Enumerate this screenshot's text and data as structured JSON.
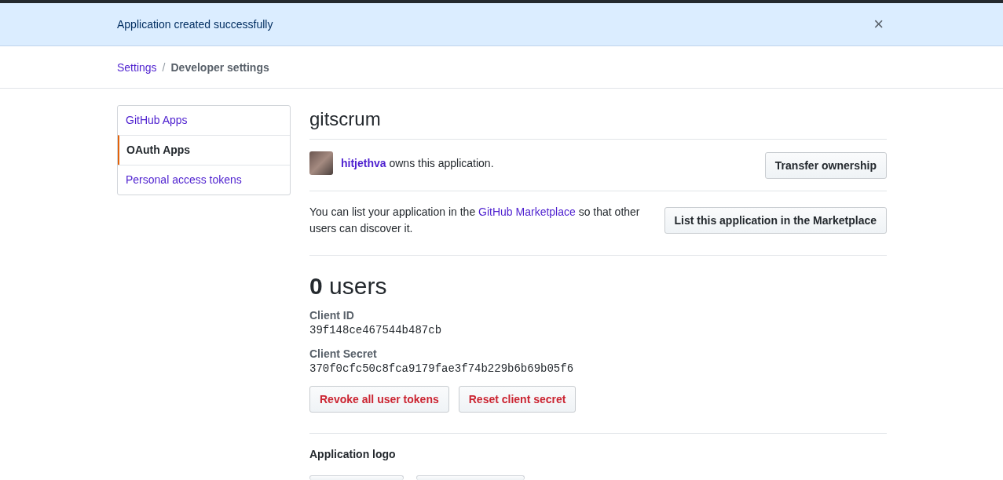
{
  "flash": {
    "message": "Application created successfully",
    "close": "×"
  },
  "breadcrumb_separator": "/",
  "breadcrumb": [
    {
      "label": "Settings",
      "kind": "link"
    },
    {
      "label": "Developer settings",
      "kind": "current"
    }
  ],
  "sidebar": {
    "items": [
      {
        "label": "GitHub Apps",
        "selected": false
      },
      {
        "label": "OAuth Apps",
        "selected": true
      },
      {
        "label": "Personal access tokens",
        "selected": false
      }
    ]
  },
  "app": {
    "name": "gitscrum",
    "owner": {
      "user": "hitjethva",
      "text": "owns this application."
    },
    "transfer_button": "Transfer ownership",
    "marketplace": {
      "before": "You can list your application in the ",
      "link": "GitHub Marketplace",
      "after": " so that other users can discover it.",
      "button": "List this application in the Marketplace"
    },
    "users": "**0** users",
    "fields": [
      {
        "label": "Client ID",
        "value": "39f148ce467544b487cb"
      },
      {
        "label": "Client Secret",
        "value": "370f0cfc50c8fca9179fae3f74b229b6b69b05f6"
      }
    ],
    "danger_buttons": [
      "Revoke all user tokens",
      "Reset client secret"
    ],
    "logo_heading": "Application logo"
  }
}
